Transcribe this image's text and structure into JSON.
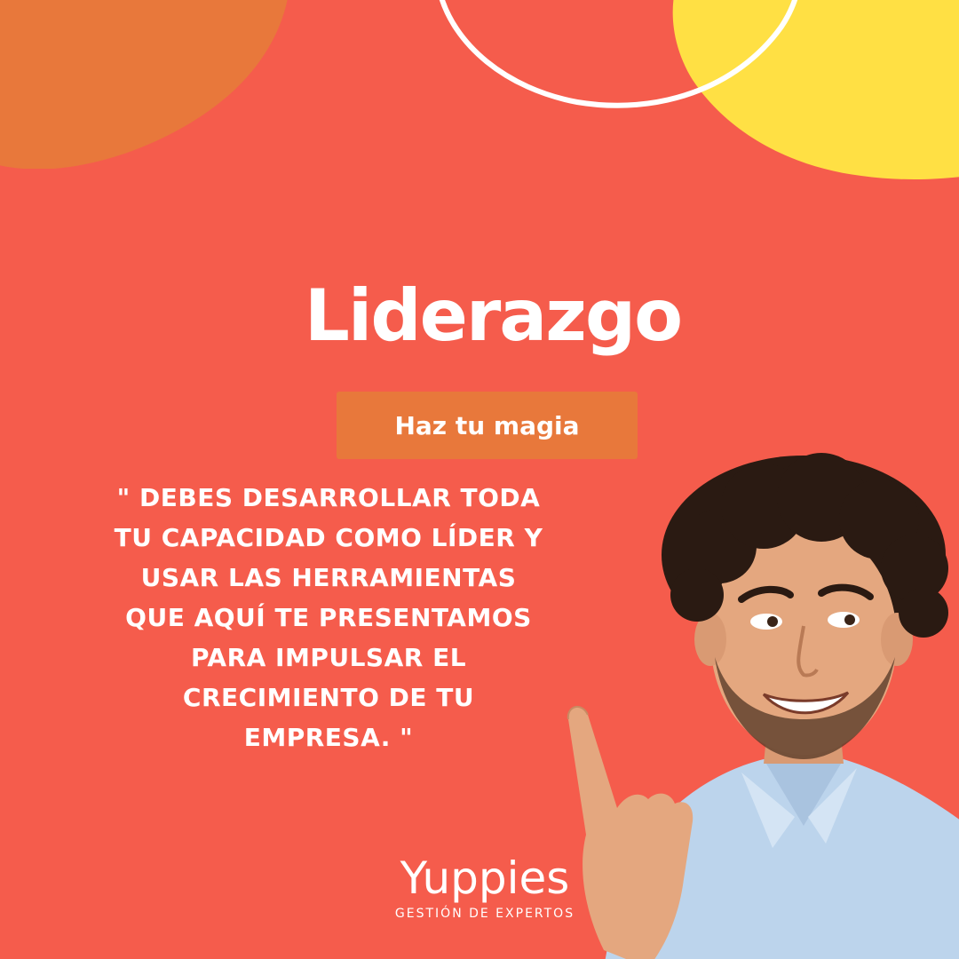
{
  "title": "Liderazgo",
  "cta_label": "Haz tu magia",
  "quote_lines": [
    "\" DEBES DESARROLLAR TODA",
    "TU CAPACIDAD COMO LÍDER Y",
    "USAR LAS HERRAMIENTAS",
    "QUE AQUÍ TE PRESENTAMOS",
    "PARA IMPULSAR EL",
    "CRECIMIENTO DE TU",
    "EMPRESA.  \""
  ],
  "brand": {
    "name": "Yuppies",
    "tagline": "GESTIÓN DE EXPERTOS"
  },
  "colors": {
    "background": "#f55c4c",
    "orange_blob": "#e8783b",
    "yellow_blob": "#ffe044",
    "button": "#e8783b",
    "text": "#ffffff"
  },
  "icons": [
    "decorative-orange-blob",
    "decorative-yellow-blob",
    "decorative-white-loop",
    "smiling-man-pointing-photo"
  ]
}
